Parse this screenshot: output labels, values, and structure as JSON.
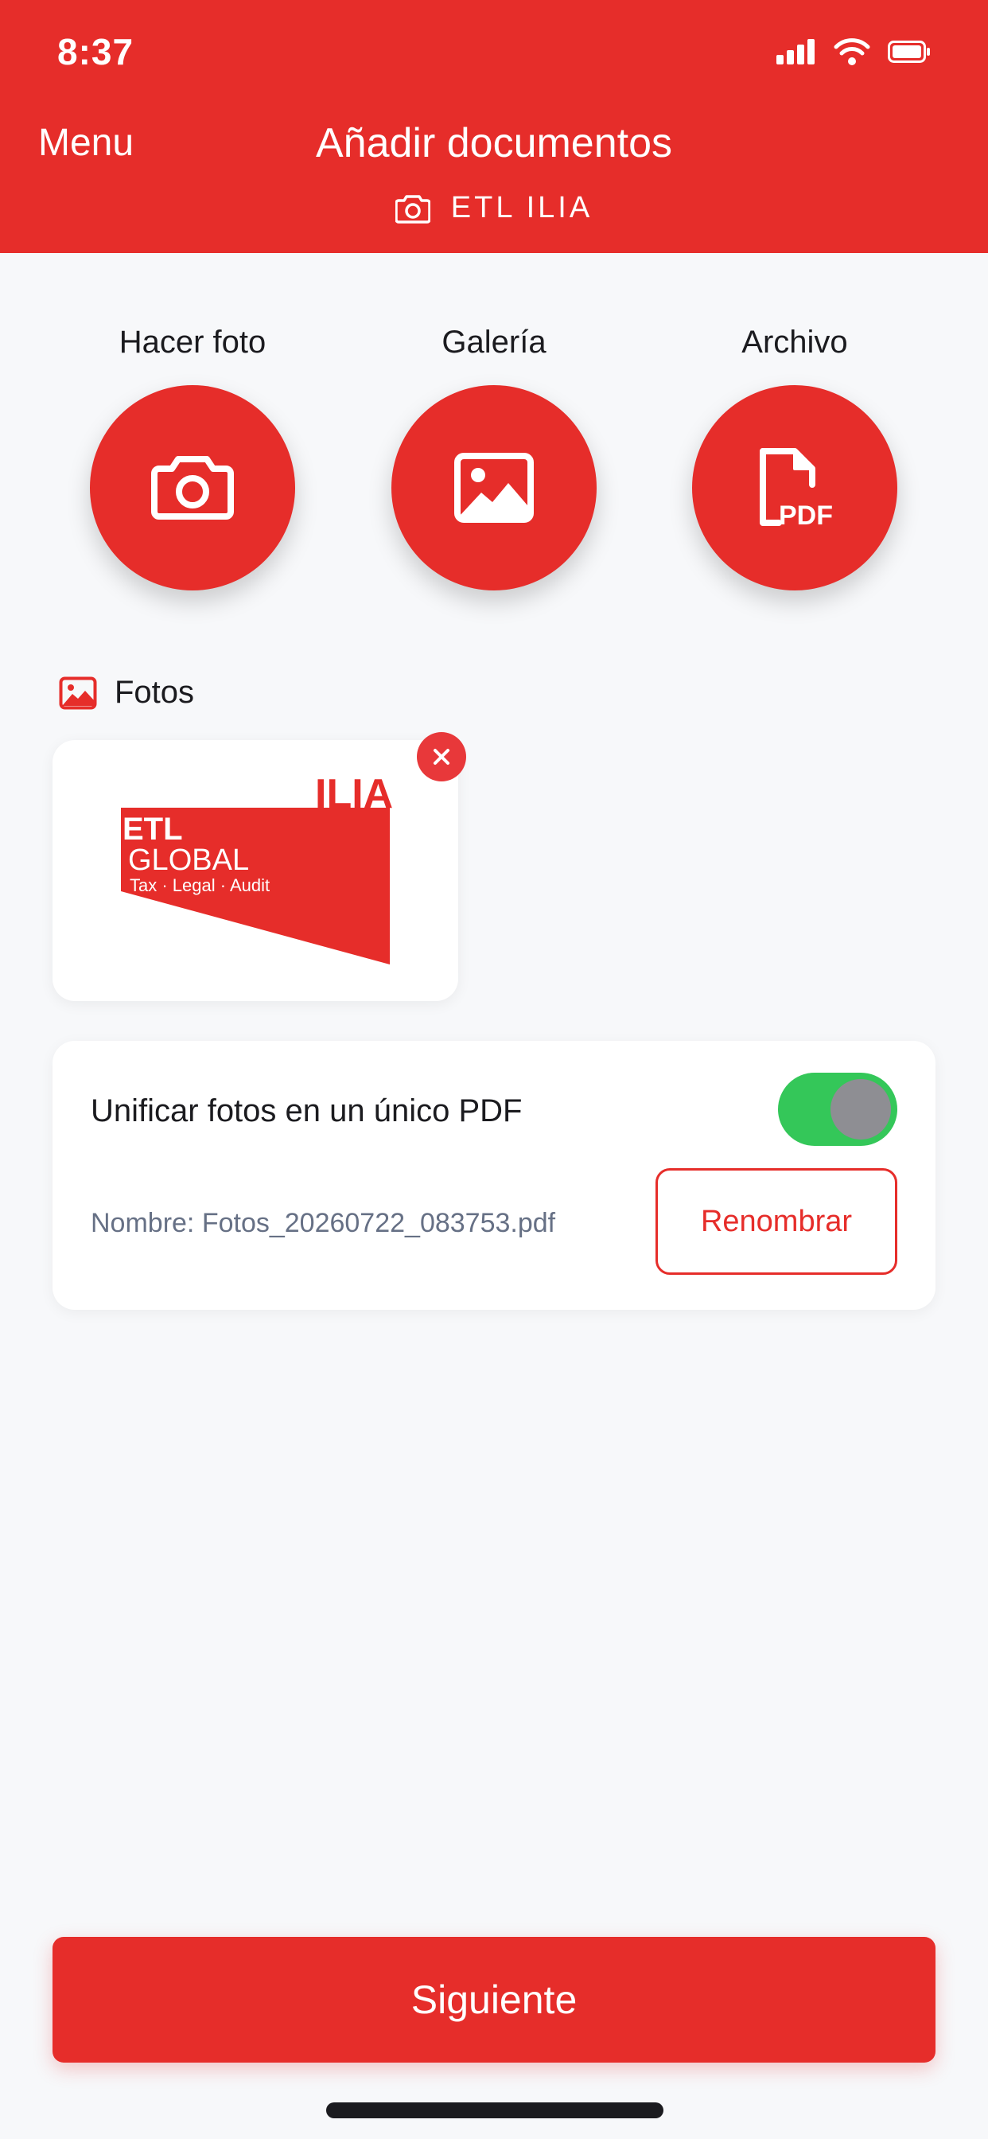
{
  "status_bar": {
    "time": "8:37"
  },
  "header": {
    "menu_label": "Menu",
    "title": "Añadir documentos",
    "subtitle": "ETL ILIA"
  },
  "actions": [
    {
      "label": "Hacer foto",
      "icon": "camera-icon"
    },
    {
      "label": "Galería",
      "icon": "image-icon"
    },
    {
      "label": "Archivo",
      "icon": "pdf-file-icon"
    }
  ],
  "photos_section": {
    "title": "Fotos"
  },
  "photo_thumb": {
    "logo_texts": [
      "ILIA",
      "ETL",
      "GLOBAL",
      "Tax · Legal · Audit"
    ]
  },
  "merge_card": {
    "label": "Unificar fotos en un único PDF",
    "toggle_on": true,
    "file_name": "Nombre: Fotos_20260722_083753.pdf",
    "rename_label": "Renombrar"
  },
  "footer": {
    "next_label": "Siguiente"
  },
  "colors": {
    "brand_red": "#e62d2a",
    "toggle_green": "#34c759",
    "background": "#f7f8fa"
  }
}
